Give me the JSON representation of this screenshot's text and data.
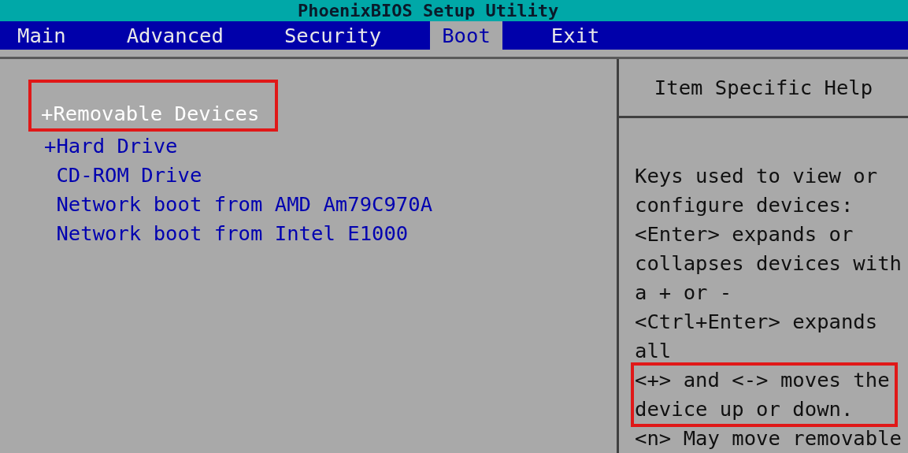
{
  "window": {
    "title": "PhoenixBIOS Setup Utility"
  },
  "tabs": [
    {
      "label": "Main",
      "selected": false
    },
    {
      "label": "Advanced",
      "selected": false
    },
    {
      "label": "Security",
      "selected": false
    },
    {
      "label": "Boot",
      "selected": true
    },
    {
      "label": "Exit",
      "selected": false
    }
  ],
  "boot_items": [
    {
      "marker": "+",
      "label": "Removable Devices",
      "selected": true,
      "highlighted": true
    },
    {
      "marker": "+",
      "label": "Hard Drive",
      "selected": false,
      "highlighted": false
    },
    {
      "label": "CD-ROM Drive",
      "selected": false,
      "highlighted": false
    },
    {
      "label": "Network boot from AMD Am79C970A",
      "selected": false,
      "highlighted": false
    },
    {
      "label": "Network boot from Intel E1000",
      "selected": false,
      "highlighted": false
    }
  ],
  "help": {
    "title": "Item Specific Help",
    "blocks": [
      {
        "highlighted": false,
        "lines": [
          "Keys used to view or",
          "configure devices:",
          "<Enter> expands or",
          "collapses devices with",
          "a + or -",
          "<Ctrl+Enter> expands",
          "all"
        ]
      },
      {
        "highlighted": true,
        "lines": [
          "<+> and <-> moves the",
          "device up or down."
        ]
      },
      {
        "highlighted": false,
        "lines": [
          "<n> May move removable"
        ]
      }
    ]
  }
}
